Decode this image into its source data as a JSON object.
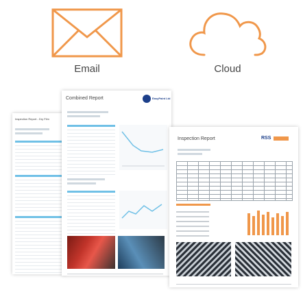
{
  "icons": {
    "email_label": "Email",
    "cloud_label": "Cloud",
    "email_icon": "envelope-icon",
    "cloud_icon": "cloud-icon",
    "accent_color": "#f0974a"
  },
  "reports": {
    "back": {
      "title": "Inspection Report - Dry Film",
      "section_color": "#6fc0e6"
    },
    "middle": {
      "title": "Combined Report",
      "logo_text": "EasyPaint Ltd",
      "section_color": "#6fc0e6"
    },
    "front": {
      "title": "Inspection Report",
      "logo_text": "RSS",
      "accent_color": "#f0974a",
      "section_color": "#6fc0e6"
    }
  }
}
